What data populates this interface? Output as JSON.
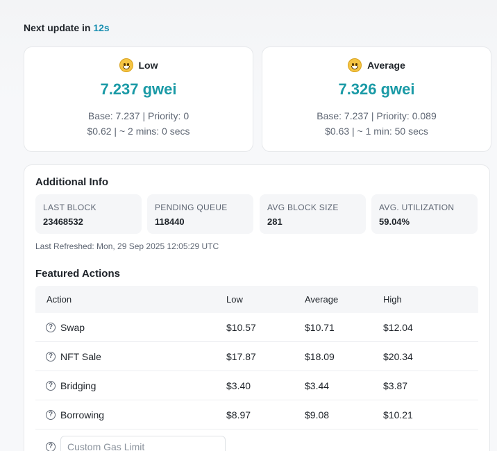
{
  "header": {
    "next_update_prefix": "Next update in",
    "next_update_value": "12s"
  },
  "gas_cards": [
    {
      "label": "Low",
      "price": "7.237 gwei",
      "base_priority": "Base: 7.237 | Priority: 0",
      "cost_time": "$0.62 | ~ 2 mins: 0 secs"
    },
    {
      "label": "Average",
      "price": "7.326 gwei",
      "base_priority": "Base: 7.237 | Priority: 0.089",
      "cost_time": "$0.63 | ~ 1 min: 50 secs"
    }
  ],
  "additional_info": {
    "title": "Additional Info",
    "stats": [
      {
        "label": "LAST BLOCK",
        "value": "23468532"
      },
      {
        "label": "PENDING QUEUE",
        "value": "118440"
      },
      {
        "label": "AVG BLOCK SIZE",
        "value": "281"
      },
      {
        "label": "AVG. UTILIZATION",
        "value": "59.04%"
      }
    ],
    "last_refreshed": "Last Refreshed: Mon, 29 Sep 2025 12:05:29 UTC"
  },
  "featured_actions": {
    "title": "Featured Actions",
    "columns": [
      "Action",
      "Low",
      "Average",
      "High"
    ],
    "rows": [
      {
        "action": "Swap",
        "low": "$10.57",
        "average": "$10.71",
        "high": "$12.04"
      },
      {
        "action": "NFT Sale",
        "low": "$17.87",
        "average": "$18.09",
        "high": "$20.34"
      },
      {
        "action": "Bridging",
        "low": "$3.40",
        "average": "$3.44",
        "high": "$3.87"
      },
      {
        "action": "Borrowing",
        "low": "$8.97",
        "average": "$9.08",
        "high": "$10.21"
      }
    ],
    "custom_gas_placeholder": "Custom Gas Limit"
  },
  "icons": {
    "low_emoji": "grinning-face-icon",
    "avg_emoji": "smiling-face-icon",
    "help": "question-circle-icon"
  },
  "colors": {
    "accent": "#1a8fb1",
    "gas_price": "#1a9aa6"
  }
}
